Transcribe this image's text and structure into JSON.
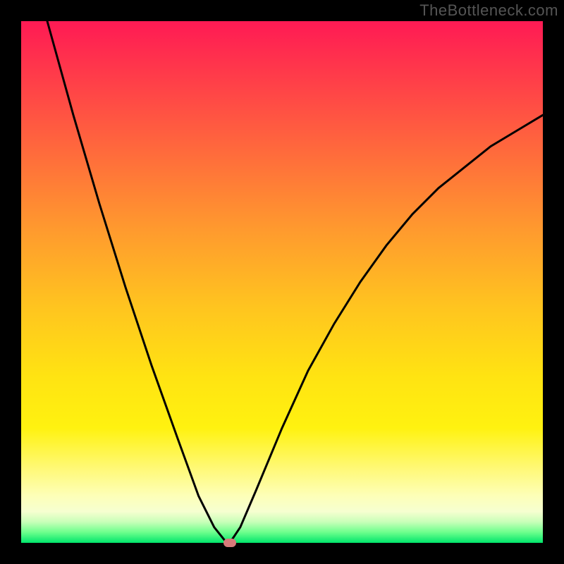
{
  "watermark": "TheBottleneck.com",
  "chart_data": {
    "type": "line",
    "title": "",
    "xlabel": "",
    "ylabel": "",
    "xlim": [
      0,
      100
    ],
    "ylim": [
      0,
      100
    ],
    "grid": false,
    "legend": false,
    "series": [
      {
        "name": "left-branch",
        "x": [
          5,
          10,
          15,
          20,
          25,
          30,
          34,
          37,
          39,
          40
        ],
        "values": [
          100,
          82,
          65,
          49,
          34,
          20,
          9,
          3,
          0.5,
          0
        ]
      },
      {
        "name": "right-branch",
        "x": [
          40,
          42,
          45,
          50,
          55,
          60,
          65,
          70,
          75,
          80,
          85,
          90,
          95,
          100
        ],
        "values": [
          0,
          3,
          10,
          22,
          33,
          42,
          50,
          57,
          63,
          68,
          72,
          76,
          79,
          82
        ]
      }
    ],
    "marker": {
      "x": 40,
      "y": 0,
      "color": "#d77a7a"
    },
    "gradient_stops": [
      {
        "pos": 0.0,
        "color": "#ff1a54"
      },
      {
        "pos": 0.25,
        "color": "#ff6a3c"
      },
      {
        "pos": 0.55,
        "color": "#ffc51f"
      },
      {
        "pos": 0.78,
        "color": "#fff210"
      },
      {
        "pos": 0.94,
        "color": "#f6ffd0"
      },
      {
        "pos": 1.0,
        "color": "#00e56b"
      }
    ]
  }
}
